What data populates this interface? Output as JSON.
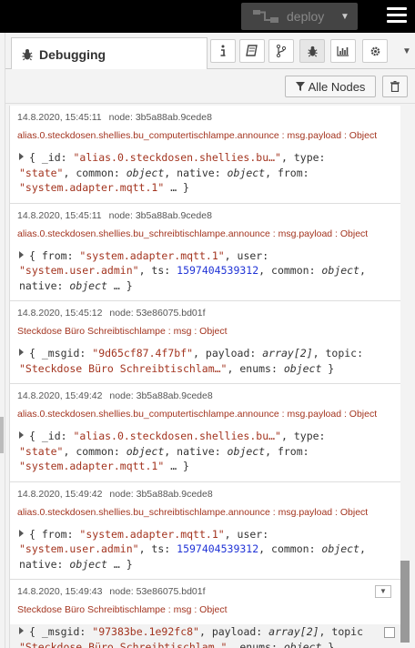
{
  "header": {
    "deploy_label": "deploy"
  },
  "tabs": {
    "active_label": "Debugging"
  },
  "toolbar": {
    "filter_label": "Alle Nodes"
  },
  "messages": [
    {
      "timestamp": "14.8.2020, 15:45:11",
      "node": "node: 3b5a88ab.9cede8",
      "topic": "alias.0.steckdosen.shellies.bu_computertischlampe.announce : msg.payload : Object"
    },
    {
      "timestamp": "14.8.2020, 15:45:11",
      "node": "node: 3b5a88ab.9cede8",
      "topic": "alias.0.steckdosen.shellies.bu_schreibtischlampe.announce : msg.payload : Object"
    },
    {
      "timestamp": "14.8.2020, 15:45:12",
      "node": "node: 53e86075.bd01f",
      "topic": "Steckdose Büro Schreibtischlampe : msg : Object"
    },
    {
      "timestamp": "14.8.2020, 15:49:42",
      "node": "node: 3b5a88ab.9cede8",
      "topic": "alias.0.steckdosen.shellies.bu_computertischlampe.announce : msg.payload : Object"
    },
    {
      "timestamp": "14.8.2020, 15:49:42",
      "node": "node: 3b5a88ab.9cede8",
      "topic": "alias.0.steckdosen.shellies.bu_schreibtischlampe.announce : msg.payload : Object"
    },
    {
      "timestamp": "14.8.2020, 15:49:43",
      "node": "node: 53e86075.bd01f",
      "topic": "Steckdose Büro Schreibtischlampe : msg : Object"
    }
  ],
  "payloads": {
    "id_key": "_id",
    "id_val_computer": "\"alias.0.steckdosen.shellies.bu…\"",
    "type_key": "type",
    "type_val": "\"state\"",
    "common_key": "common",
    "object_word": "object",
    "native_key": "native",
    "from_key": "from",
    "from_val": "\"system.adapter.mqtt.1\"",
    "user_key": "user",
    "user_val": "\"system.user.admin\"",
    "ts_key": "ts",
    "ts_val": "1597404539312",
    "msgid_key": "_msgid",
    "msgid_val_1": "\"9d65cf87.4f7bf\"",
    "msgid_val_2": "\"97383be.1e92fc8\"",
    "payload_key": "payload",
    "payload_val": "array[2]",
    "topic_key": "topic",
    "topic_key_cut": "topic",
    "topic_val": "\"Steckdose Büro Schreibtischlam…\"",
    "enums_key": "enums",
    "ellipsis": "…"
  },
  "colors": {
    "topic": "#a3341f",
    "number": "#2033d6",
    "key": "#792e90"
  }
}
